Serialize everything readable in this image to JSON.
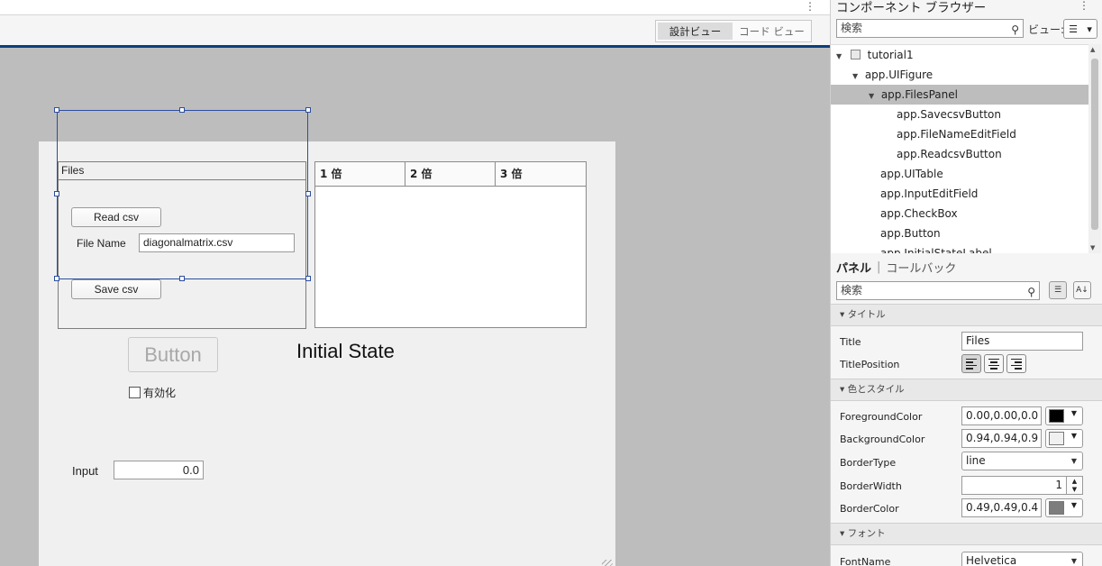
{
  "editor": {
    "view_toggle": {
      "design": "設計ビュー",
      "code": "コード ビュー"
    }
  },
  "canvas": {
    "files_panel": {
      "title": "Files",
      "read_button": "Read csv",
      "file_name_label": "File Name",
      "file_name_value": "diagonalmatrix.csv",
      "save_button": "Save csv"
    },
    "table": {
      "columns": [
        "1 倍",
        "2 倍",
        "3 倍"
      ]
    },
    "button_label": "Button",
    "initial_state_label": "Initial State",
    "checkbox_label": "有効化",
    "input_label": "Input",
    "input_value": "0.0"
  },
  "browser": {
    "title": "コンポーネント ブラウザー",
    "search_placeholder": "検索",
    "view_label": "ビュー:",
    "tree": [
      {
        "label": "tutorial1"
      },
      {
        "label": "app.UIFigure"
      },
      {
        "label": "app.FilesPanel"
      },
      {
        "label": "app.SavecsvButton"
      },
      {
        "label": "app.FileNameEditField"
      },
      {
        "label": "app.ReadcsvButton"
      },
      {
        "label": "app.UITable"
      },
      {
        "label": "app.InputEditField"
      },
      {
        "label": "app.CheckBox"
      },
      {
        "label": "app.Button"
      },
      {
        "label": "app.InitialStateLabel"
      }
    ],
    "tabs": {
      "panel": "パネル",
      "callback": "コールバック"
    },
    "prop_search_placeholder": "検索",
    "sections": {
      "title": "タイトル",
      "color_style": "色とスタイル",
      "font": "フォント"
    },
    "props": {
      "title_name": "Title",
      "title_value": "Files",
      "title_position_name": "TitlePosition",
      "fg_name": "ForegroundColor",
      "fg_value": "0.00,0.00,0.0",
      "fg_color": "#000000",
      "bg_name": "BackgroundColor",
      "bg_value": "0.94,0.94,0.9",
      "bg_color": "#f0f0f0",
      "border_type_name": "BorderType",
      "border_type_value": "line",
      "border_width_name": "BorderWidth",
      "border_width_value": "1",
      "border_color_name": "BorderColor",
      "border_color_value": "0.49,0.49,0.4",
      "border_color": "#7d7d7d",
      "font_name_name": "FontName",
      "font_name_value": "Helvetica"
    }
  }
}
